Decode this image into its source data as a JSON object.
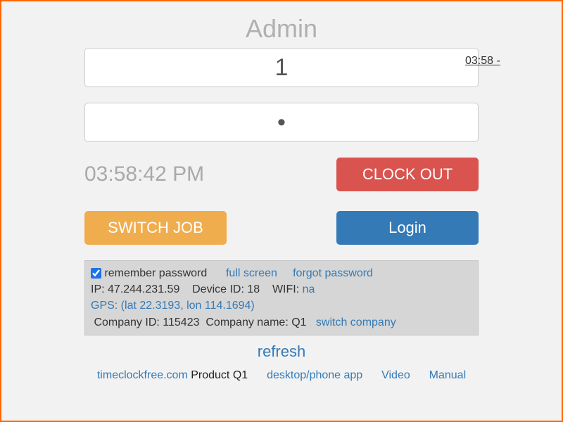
{
  "title": "Admin",
  "username_value": "1",
  "password_value": "•",
  "side_time": "03:58 -",
  "clock_display": "03:58:42 PM",
  "buttons": {
    "clock_out": "CLOCK OUT",
    "switch_job": "SWITCH JOB",
    "login": "Login"
  },
  "info": {
    "remember_label": "remember password",
    "full_screen": "full screen",
    "forgot_password": "forgot password",
    "ip_label": "IP:",
    "ip_value": "47.244.231.59",
    "device_label": "Device ID:",
    "device_value": "18",
    "wifi_label": "WIFI:",
    "wifi_value": "na",
    "gps_text": "GPS: (lat 22.3193, lon 114.1694)",
    "company_id_label": "Company ID:",
    "company_id_value": "115423",
    "company_name_label": "Company name:",
    "company_name_value": "Q1",
    "switch_company": "switch company"
  },
  "refresh": "refresh",
  "footer": {
    "site": "timeclockfree.com",
    "product": "Product Q1",
    "app": "desktop/phone app",
    "video": "Video",
    "manual": "Manual"
  }
}
